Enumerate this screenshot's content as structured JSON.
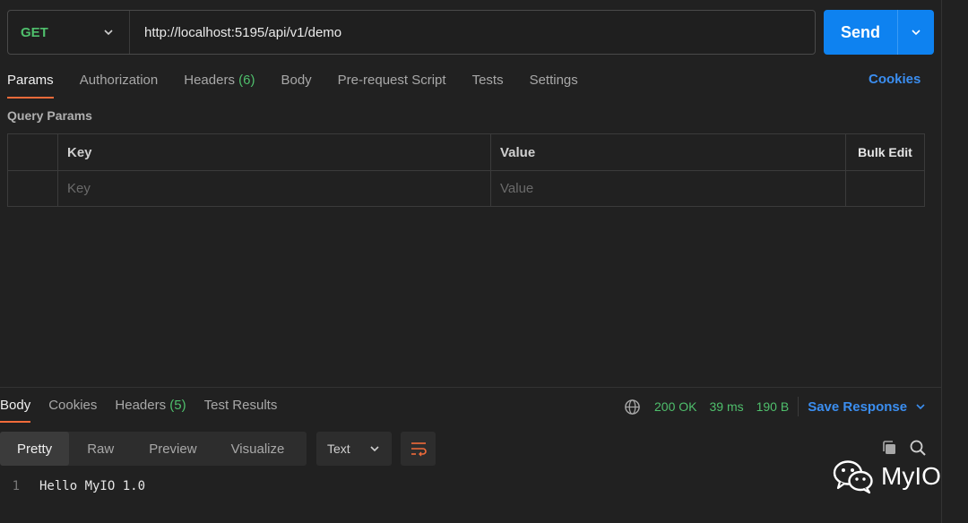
{
  "request": {
    "method": "GET",
    "url": "http://localhost:5195/api/v1/demo",
    "send_label": "Send"
  },
  "request_tabs": [
    {
      "label": "Params",
      "count": ""
    },
    {
      "label": "Authorization",
      "count": ""
    },
    {
      "label": "Headers",
      "count": "(6)"
    },
    {
      "label": "Body",
      "count": ""
    },
    {
      "label": "Pre-request Script",
      "count": ""
    },
    {
      "label": "Tests",
      "count": ""
    },
    {
      "label": "Settings",
      "count": ""
    }
  ],
  "cookies_link": "Cookies",
  "query_params": {
    "title": "Query Params",
    "headers": {
      "key": "Key",
      "value": "Value",
      "bulk_edit": "Bulk Edit"
    },
    "placeholder": {
      "key": "Key",
      "value": "Value"
    }
  },
  "response_tabs": [
    {
      "label": "Body",
      "count": ""
    },
    {
      "label": "Cookies",
      "count": ""
    },
    {
      "label": "Headers",
      "count": "(5)"
    },
    {
      "label": "Test Results",
      "count": ""
    }
  ],
  "response_meta": {
    "status": "200 OK",
    "time": "39 ms",
    "size": "190 B",
    "save_label": "Save Response"
  },
  "view_modes": [
    "Pretty",
    "Raw",
    "Preview",
    "Visualize"
  ],
  "format": "Text",
  "code": {
    "line_number": "1",
    "text": "Hello MyIO 1.0"
  },
  "watermark": "MyIO",
  "colors": {
    "accent_blue": "#0e82f0",
    "get_green": "#4fbf6c",
    "tab_underline": "#f26b3a",
    "wrap_icon": "#f26b3a"
  }
}
